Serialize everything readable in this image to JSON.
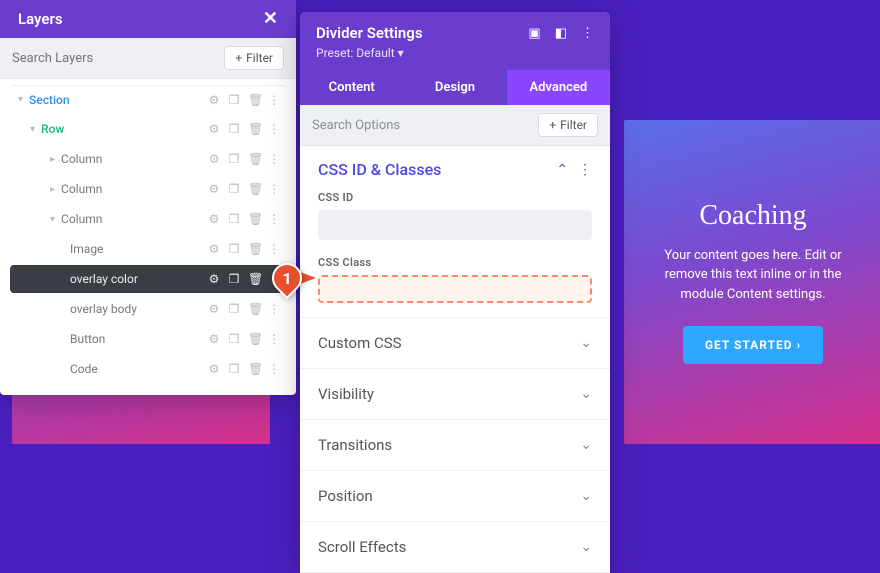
{
  "layers": {
    "title": "Layers",
    "search_placeholder": "Search Layers",
    "filter_label": "Filter",
    "items": [
      {
        "label": "Section",
        "kind": "section"
      },
      {
        "label": "Row",
        "kind": "row"
      },
      {
        "label": "Column"
      },
      {
        "label": "Column"
      },
      {
        "label": "Column"
      },
      {
        "label": "Image"
      },
      {
        "label": "overlay color",
        "active": true
      },
      {
        "label": "overlay body"
      },
      {
        "label": "Button"
      },
      {
        "label": "Code"
      }
    ]
  },
  "settings": {
    "title": "Divider Settings",
    "preset": "Preset: Default",
    "tabs": {
      "content": "Content",
      "design": "Design",
      "advanced": "Advanced"
    },
    "search": "Search Options",
    "filter": "Filter",
    "cssid_section": "CSS ID & Classes",
    "cssid_label": "CSS ID",
    "cssclass_label": "CSS Class",
    "collapsed": [
      "Custom CSS",
      "Visibility",
      "Transitions",
      "Position",
      "Scroll Effects"
    ]
  },
  "card": {
    "title": "Coaching",
    "body": "Your content goes here. Edit or remove this text inline or in the module Content settings.",
    "cta": "GET STARTED  ›"
  },
  "marker": "1"
}
